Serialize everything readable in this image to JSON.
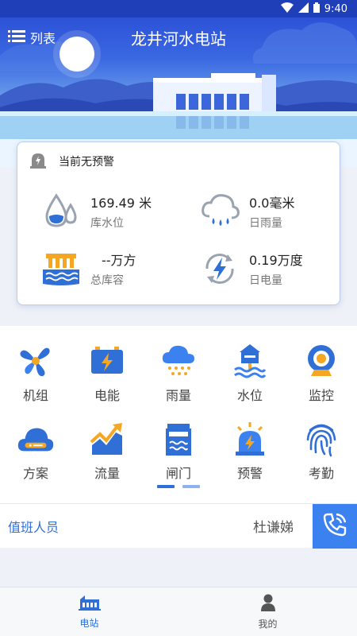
{
  "status_bar": {
    "time": "9:40",
    "icons": [
      "wifi-icon",
      "signal-icon",
      "battery-icon"
    ]
  },
  "header": {
    "menu_label": "列表",
    "menu_icon": "list-icon",
    "title": "龙井河水电站"
  },
  "alert": {
    "icon": "alert-icon",
    "text": "当前无预警"
  },
  "metrics": {
    "water_level": {
      "value": "169.49 米",
      "label": "库水位",
      "icon": "water-drop-icon"
    },
    "rainfall": {
      "value": "0.0毫米",
      "label": "日雨量",
      "icon": "rain-cloud-icon"
    },
    "storage": {
      "value": "--万方",
      "label": "总库容",
      "icon": "reservoir-icon"
    },
    "power": {
      "value": "0.19万度",
      "label": "日电量",
      "icon": "power-cycle-icon"
    }
  },
  "functions": {
    "row1": [
      {
        "label": "机组",
        "icon": "fan-icon"
      },
      {
        "label": "电能",
        "icon": "battery-icon"
      },
      {
        "label": "雨量",
        "icon": "rain-icon"
      },
      {
        "label": "水位",
        "icon": "water-gauge-icon"
      },
      {
        "label": "监控",
        "icon": "camera-icon"
      }
    ],
    "row2": [
      {
        "label": "方案",
        "icon": "cloud-plan-icon"
      },
      {
        "label": "流量",
        "icon": "trend-chart-icon"
      },
      {
        "label": "闸门",
        "icon": "gate-icon"
      },
      {
        "label": "预警",
        "icon": "alarm-light-icon"
      },
      {
        "label": "考勤",
        "icon": "fingerprint-icon"
      }
    ],
    "pager": {
      "pages": 2,
      "current": 1
    }
  },
  "duty": {
    "label": "值班人员",
    "name": "杜谦娣",
    "call_icon": "phone-icon"
  },
  "tabbar": {
    "tabs": [
      {
        "label": "电站",
        "icon": "station-icon",
        "active": true
      },
      {
        "label": "我的",
        "icon": "user-icon",
        "active": false
      }
    ]
  },
  "colors": {
    "primary": "#2f6fd6",
    "header_dark": "#1f3fb8",
    "accent_orange": "#f5a623",
    "call_button": "#3b82f0"
  }
}
